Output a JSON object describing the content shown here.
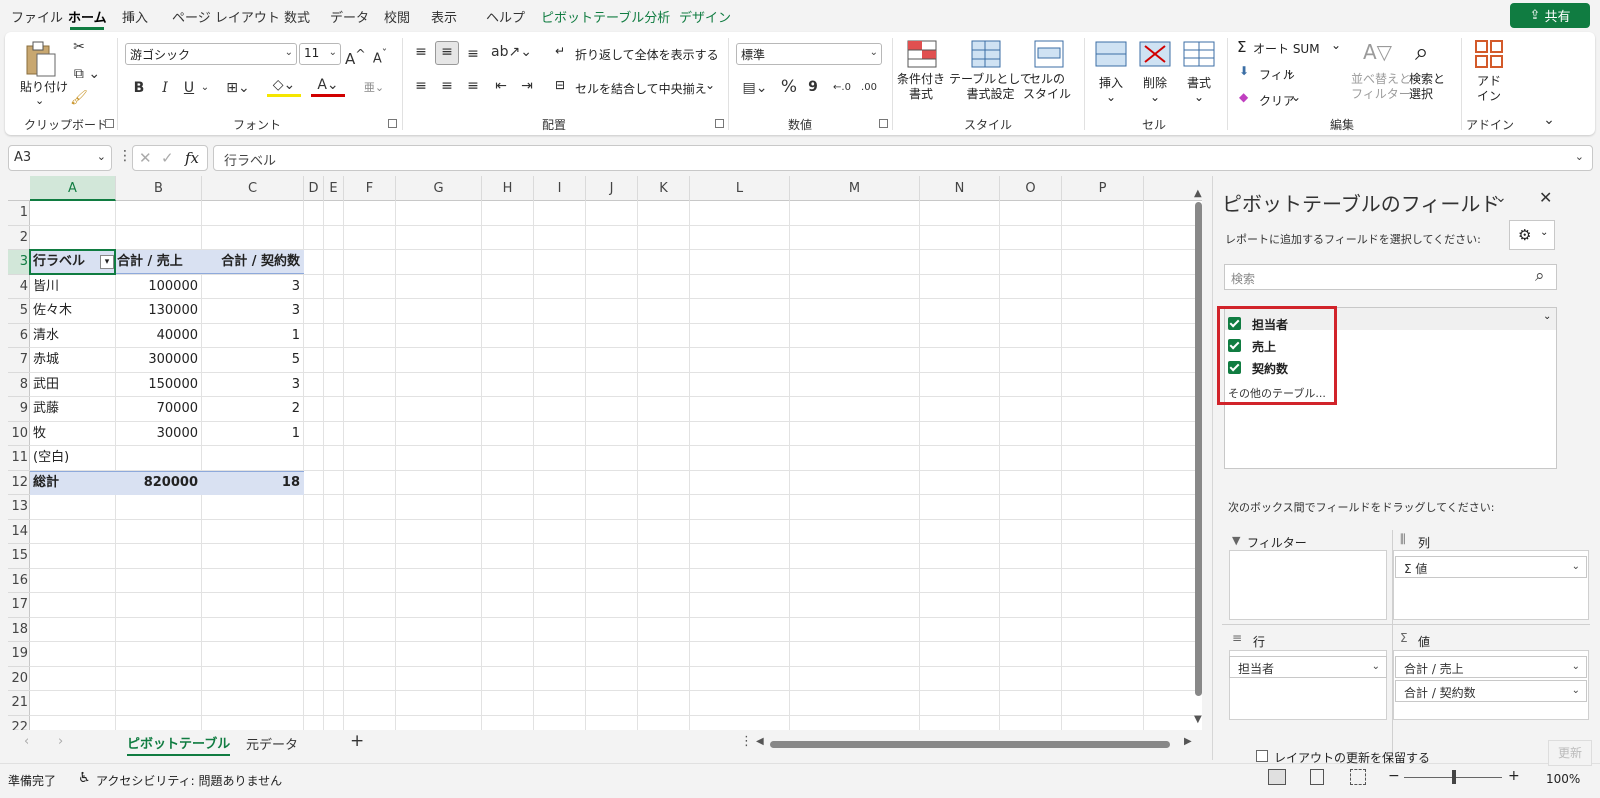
{
  "menu": {
    "items": [
      "ファイル",
      "ホーム",
      "挿入",
      "ページ レイアウト",
      "数式",
      "データ",
      "校閲",
      "表示",
      "ヘルプ",
      "ピボットテーブル分析",
      "デザイン"
    ],
    "share_label": "共有"
  },
  "ribbon": {
    "clipboard": {
      "paste": "貼り付け",
      "group": "クリップボード"
    },
    "font": {
      "name": "游ゴシック",
      "size": "11",
      "bold": "B",
      "italic": "I",
      "underline": "U",
      "grow": "A",
      "shrink": "A",
      "group": "フォント"
    },
    "alignment": {
      "wrap": "折り返して全体を表示する",
      "merge": "セルを結合して中央揃え",
      "group": "配置"
    },
    "number": {
      "format": "標準",
      "percent": "%",
      "comma": "9",
      "group": "数値"
    },
    "styles": {
      "conditional": "条件付き\n書式",
      "table": "テーブルとして\n書式設定",
      "cell": "セルの\nスタイル",
      "group": "スタイル"
    },
    "cells": {
      "insert": "挿入",
      "delete": "削除",
      "format": "書式",
      "group": "セル"
    },
    "editing": {
      "autosum": "オート SUM",
      "fill": "フィル",
      "clear": "クリア",
      "sort": "並べ替えと\nフィルター",
      "find": "検索と\n選択",
      "group": "編集"
    },
    "addins": {
      "label": "アド\nイン",
      "group": "アドイン"
    }
  },
  "formula_bar": {
    "name_box": "A3",
    "fx": "fx",
    "formula": "行ラベル"
  },
  "columns": [
    "A",
    "B",
    "C",
    "D",
    "E",
    "F",
    "G",
    "H",
    "I",
    "J",
    "K",
    "L",
    "M",
    "N",
    "O",
    "P"
  ],
  "rows": [
    "1",
    "2",
    "3",
    "4",
    "5",
    "6",
    "7",
    "8",
    "9",
    "10",
    "11",
    "12",
    "13",
    "14",
    "15",
    "16",
    "17",
    "18",
    "19",
    "20",
    "21",
    "22"
  ],
  "pivot": {
    "headers": [
      "行ラベル",
      "合計 / 売上",
      "合計 / 契約数"
    ],
    "data": [
      [
        "皆川",
        "100000",
        "3"
      ],
      [
        "佐々木",
        "130000",
        "3"
      ],
      [
        "清水",
        "40000",
        "1"
      ],
      [
        "赤城",
        "300000",
        "5"
      ],
      [
        "武田",
        "150000",
        "3"
      ],
      [
        "武藤",
        "70000",
        "2"
      ],
      [
        "牧",
        "30000",
        "1"
      ],
      [
        "(空白)",
        "",
        ""
      ]
    ],
    "total": [
      "総計",
      "820000",
      "18"
    ]
  },
  "sheets": {
    "tabs": [
      "ピボットテーブル",
      "元データ"
    ],
    "add": "+"
  },
  "status": {
    "ready": "準備完了",
    "accessibility": "アクセシビリティ: 問題ありません",
    "zoom": "100%"
  },
  "pane": {
    "title": "ピボットテーブルのフィールド",
    "instruction": "レポートに追加するフィールドを選択してください:",
    "search_placeholder": "検索",
    "fields": [
      "担当者",
      "売上",
      "契約数"
    ],
    "more_tables": "その他のテーブル...",
    "drag_hint": "次のボックス間でフィールドをドラッグしてください:",
    "filter_label": "フィルター",
    "columns_label": "列",
    "rows_label": "行",
    "values_label": "値",
    "columns_item": "Σ 値",
    "rows_item": "担当者",
    "values_items": [
      "合計 / 売上",
      "合計 / 契約数"
    ],
    "defer_label": "レイアウトの更新を保留する",
    "update_label": "更新"
  },
  "colors": {
    "accent": "#107c41",
    "highlight_box": "#d1232a",
    "total_row": "#d9e1f2"
  }
}
